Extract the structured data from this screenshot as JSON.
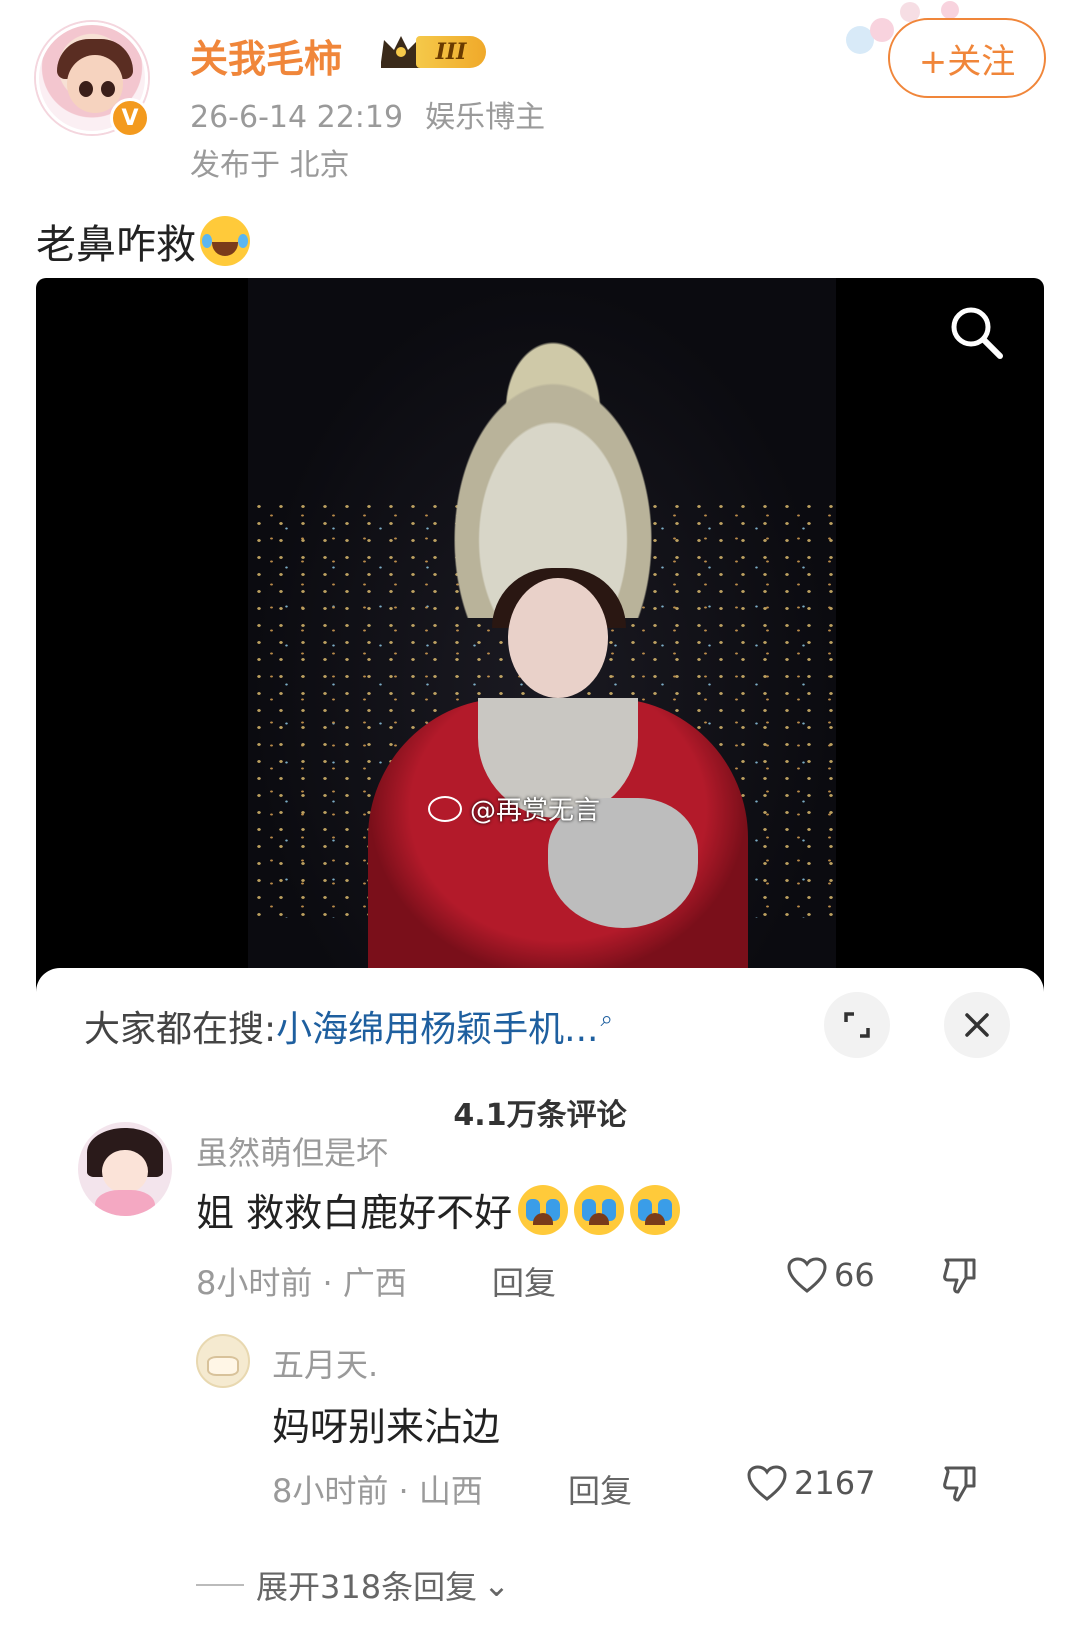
{
  "post": {
    "username": "关我毛柿",
    "rank_level": "III",
    "timestamp": "26-6-14 22:19",
    "category": "娱乐博主",
    "location": "发布于 北京",
    "follow_label": "+关注",
    "text": "老鼻咋救",
    "text_emoji": "laughing-tears-emoji"
  },
  "media": {
    "watermark": "@再赏无言",
    "search_icon": "search-icon"
  },
  "sheet": {
    "hot_search_label": "大家都在搜:",
    "hot_search_query": "小海绵用杨颖手机...",
    "comment_count": "4.1万条评论",
    "comments": [
      {
        "name": "虽然萌但是坏",
        "text": "姐 救救白鹿好不好",
        "emoji": "crying-emoji",
        "time": "8小时前 · 广西",
        "reply_label": "回复",
        "likes": "66"
      },
      {
        "name": "五月天.",
        "text": "妈呀别来沾边",
        "time": "8小时前 · 山西",
        "reply_label": "回复",
        "likes": "2167"
      }
    ],
    "expand_replies": "展开318条回复"
  },
  "colors": {
    "accent": "#f0863a",
    "link": "#1e5f9f",
    "muted": "#9a9a9a"
  }
}
